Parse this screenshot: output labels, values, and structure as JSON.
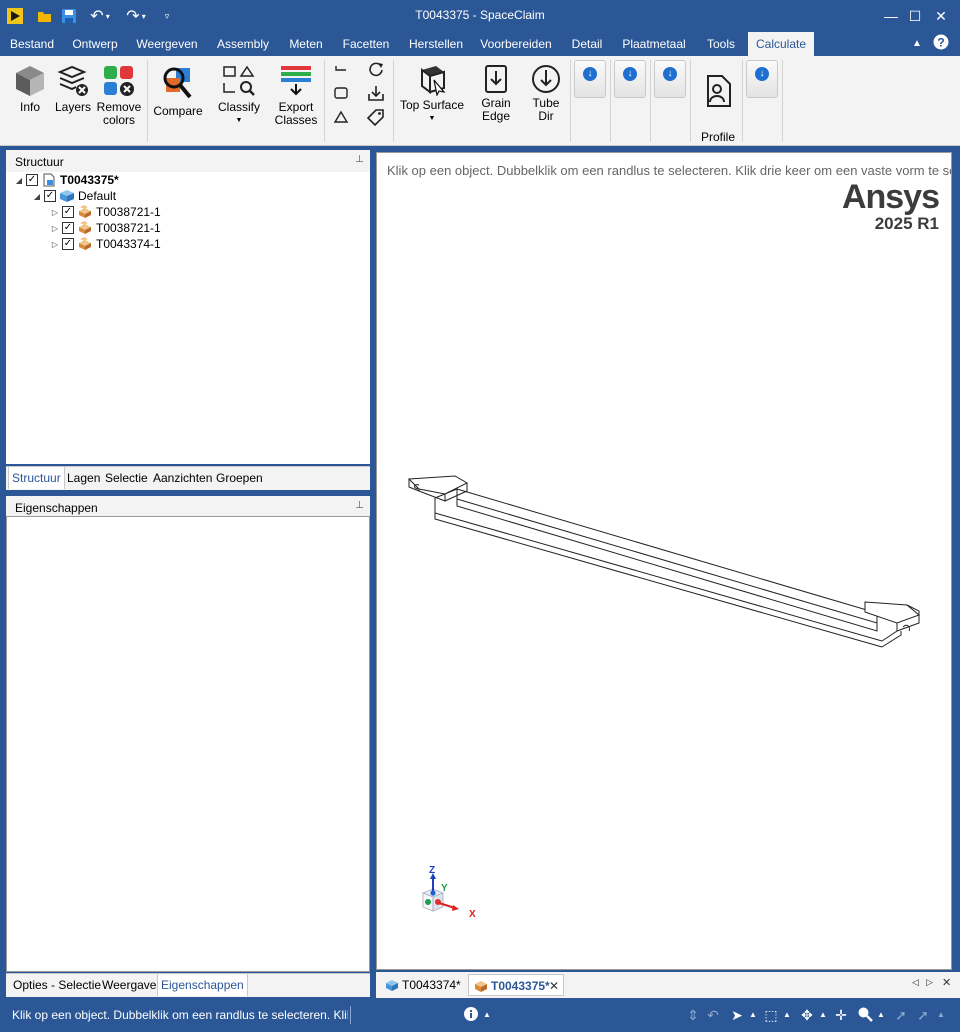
{
  "app": {
    "title": "T0043375 - SpaceClaim",
    "window_controls": {
      "minimize": "—",
      "maximize": "☐",
      "close": "✕"
    }
  },
  "ribbon_tabs": [
    "Bestand",
    "Ontwerp",
    "Weergeven",
    "Assembly",
    "Meten",
    "Facetten",
    "Herstellen",
    "Voorbereiden",
    "Detail",
    "Plaatmetaal",
    "Tools",
    "Calculate"
  ],
  "active_tab": "Calculate",
  "ribbon": {
    "info": "Info",
    "layers": "Layers",
    "remove_colors_1": "Remove",
    "remove_colors_2": "colors",
    "compare": "Compare",
    "classify": "Classify",
    "export_1": "Export",
    "export_2": "Classes",
    "top_surface": "Top Surface",
    "grain_1": "Grain",
    "grain_2": "Edge",
    "tube_1": "Tube",
    "tube_2": "Dir",
    "profile": "Profile"
  },
  "structure": {
    "title": "Structuur",
    "root": "T0043375*",
    "default": "Default",
    "children": [
      "T0038721-1",
      "T0038721-1",
      "T0043374-1"
    ]
  },
  "left_tabs": [
    "Structuur",
    "Lagen",
    "Selectie",
    "Aanzichten",
    "Groepen"
  ],
  "properties": {
    "title": "Eigenschappen"
  },
  "properties_tabs": [
    "Opties - Selectie",
    "Weergave",
    "Eigenschappen"
  ],
  "viewport": {
    "hint": "Klik op een object. Dubbelklik om een randlus te selecteren. Klik drie keer om een vaste vorm te se",
    "brand": "Ansys",
    "version": "2025 R1",
    "axes": {
      "x": "X",
      "y": "Y",
      "z": "Z"
    }
  },
  "doc_tabs": [
    "T0043374*",
    "T0043375*"
  ],
  "active_doc": "T0043375*",
  "status": {
    "message": "Klik op een object. Dubbelklik om een randlus te selecteren. Klik drie k"
  },
  "colors": {
    "accent": "#2b5797",
    "ribbon_bg": "#f3f3f3"
  }
}
